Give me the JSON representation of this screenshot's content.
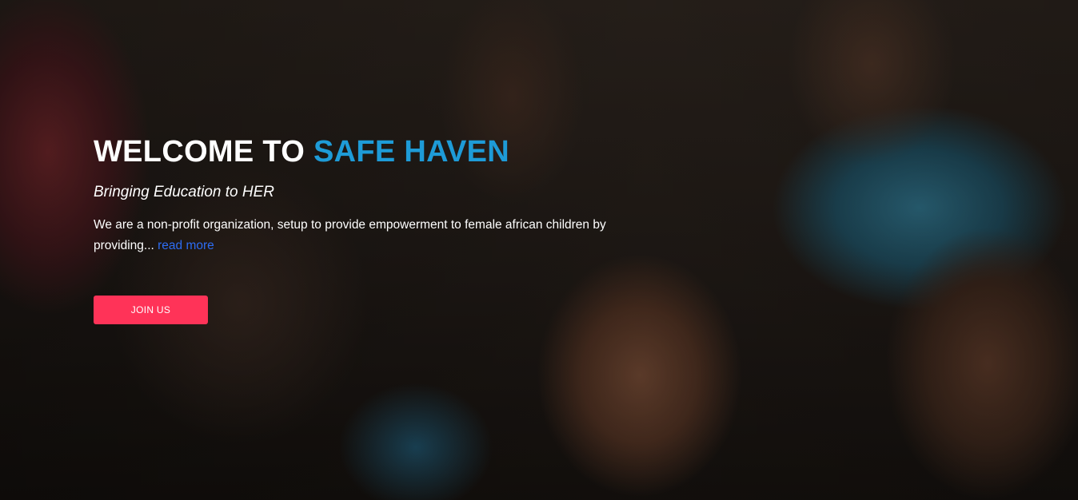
{
  "hero": {
    "headline_prefix": "WELCOME TO ",
    "headline_highlight": "SAFE HAVEN",
    "tagline": "Bringing Education to HER",
    "description": "We are a non-profit organization, setup to provide empowerment to female african children by providing...",
    "read_more_label": "read more",
    "join_button_label": "JOIN US",
    "background_image": "smiling-children-photo"
  },
  "colors": {
    "accent_blue": "#1e9bd7",
    "link_blue": "#2d6cf2",
    "button_pink": "#ff3358",
    "text_white": "#ffffff"
  }
}
